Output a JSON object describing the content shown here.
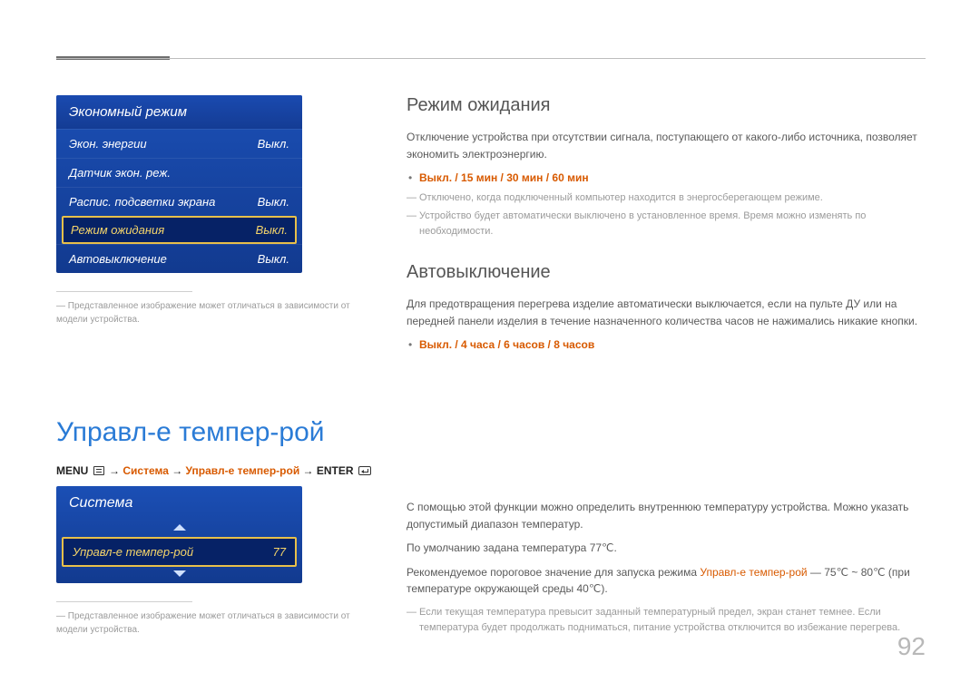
{
  "eco_menu": {
    "title": "Экономный режим",
    "items": [
      {
        "label": "Экон. энергии",
        "value": "Выкл."
      },
      {
        "label": "Датчик экон. реж.",
        "value": ""
      },
      {
        "label": "Распис. подсветки экрана",
        "value": "Выкл."
      },
      {
        "label": "Режим ожидания",
        "value": "Выкл."
      },
      {
        "label": "Автовыключение",
        "value": "Выкл."
      }
    ]
  },
  "footnote": "Представленное изображение может отличаться в зависимости от модели устройства.",
  "left_section": {
    "title": "Управл-е темпер-рой",
    "path": {
      "menu_label": "MENU",
      "p1": "Система",
      "p2": "Управл-е темпер-рой",
      "enter_label": "ENTER"
    }
  },
  "sys_menu": {
    "title": "Система",
    "item_label": "Управл-е темпер-рой",
    "item_value": "77"
  },
  "right": {
    "standby": {
      "heading": "Режим ожидания",
      "desc": "Отключение устройства при отсутствии сигнала, поступающего от какого-либо источника, позволяет экономить электроэнергию.",
      "options": "Выкл. / 15 мин / 30 мин / 60 мин",
      "note1": "Отключено, когда подключенный компьютер находится в энергосберегающем режиме.",
      "note2": "Устройство будет автоматически выключено в установленное время. Время можно изменять по необходимости."
    },
    "autooff": {
      "heading": "Автовыключение",
      "desc": "Для предотвращения перегрева изделие автоматически выключается, если на пульте ДУ или на передней панели изделия в течение назначенного количества часов не нажимались никакие кнопки.",
      "options": "Выкл. / 4 часа / 6 часов / 8 часов"
    },
    "temp": {
      "p1": "С помощью этой функции можно определить внутреннюю температуру устройства. Можно указать допустимый диапазон температур.",
      "p2": "По умолчанию задана температура 77℃.",
      "p3_a": "Рекомендуемое пороговое значение для запуска режима ",
      "p3_b": "Управл-е темпер-рой",
      "p3_c": " — 75℃ ~ 80℃ (при температуре окружающей среды 40℃).",
      "note": "Если текущая температура превысит заданный температурный предел, экран станет темнее. Если температура будет продолжать подниматься, питание устройства отключится во избежание перегрева."
    }
  },
  "page_number": "92"
}
